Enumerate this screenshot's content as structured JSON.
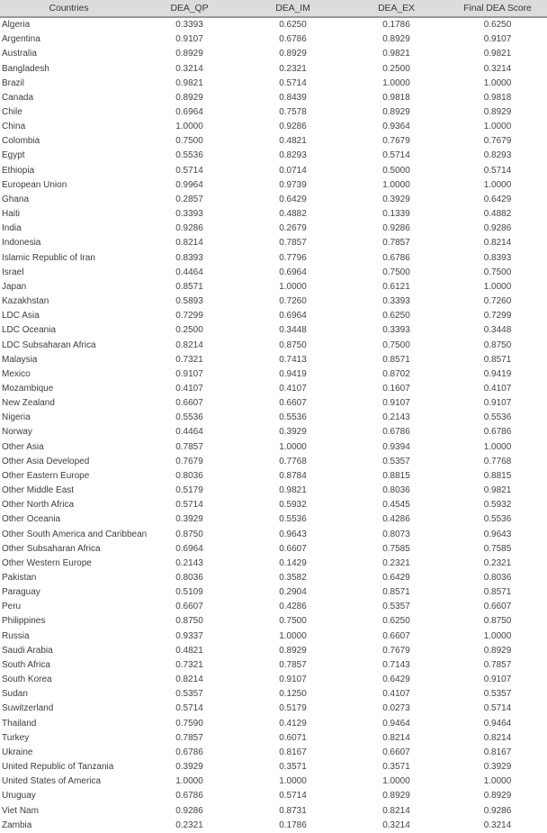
{
  "table": {
    "headers": [
      "Countries",
      "DEA_QP",
      "DEA_IM",
      "DEA_EX",
      "Final DEA Score"
    ],
    "rows": [
      [
        "Algeria",
        "0.3393",
        "0.6250",
        "0.1786",
        "0.6250"
      ],
      [
        "Argentina",
        "0.9107",
        "0.6786",
        "0.8929",
        "0.9107"
      ],
      [
        "Australia",
        "0.8929",
        "0.8929",
        "0.9821",
        "0.9821"
      ],
      [
        "Bangladesh",
        "0.3214",
        "0.2321",
        "0.2500",
        "0.3214"
      ],
      [
        "Brazil",
        "0.9821",
        "0.5714",
        "1.0000",
        "1.0000"
      ],
      [
        "Canada",
        "0.8929",
        "0.8439",
        "0.9818",
        "0.9818"
      ],
      [
        "Chile",
        "0.6964",
        "0.7578",
        "0.8929",
        "0.8929"
      ],
      [
        "China",
        "1.0000",
        "0.9286",
        "0.9364",
        "1.0000"
      ],
      [
        "Colombia",
        "0.7500",
        "0.4821",
        "0.7679",
        "0.7679"
      ],
      [
        "Egypt",
        "0.5536",
        "0.8293",
        "0.5714",
        "0.8293"
      ],
      [
        "Ethiopia",
        "0.5714",
        "0.0714",
        "0.5000",
        "0.5714"
      ],
      [
        "European Union",
        "0.9964",
        "0.9739",
        "1.0000",
        "1.0000"
      ],
      [
        "Ghana",
        "0.2857",
        "0.6429",
        "0.3929",
        "0.6429"
      ],
      [
        "Haiti",
        "0.3393",
        "0.4882",
        "0.1339",
        "0.4882"
      ],
      [
        "India",
        "0.9286",
        "0.2679",
        "0.9286",
        "0.9286"
      ],
      [
        "Indonesia",
        "0.8214",
        "0.7857",
        "0.7857",
        "0.8214"
      ],
      [
        "Islamic Republic of Iran",
        "0.8393",
        "0.7796",
        "0.6786",
        "0.8393"
      ],
      [
        "Israel",
        "0.4464",
        "0.6964",
        "0.7500",
        "0.7500"
      ],
      [
        "Japan",
        "0.8571",
        "1.0000",
        "0.6121",
        "1.0000"
      ],
      [
        "Kazakhstan",
        "0.5893",
        "0.7260",
        "0.3393",
        "0.7260"
      ],
      [
        "LDC Asia",
        "0.7299",
        "0.6964",
        "0.6250",
        "0.7299"
      ],
      [
        "LDC Oceania",
        "0.2500",
        "0.3448",
        "0.3393",
        "0.3448"
      ],
      [
        "LDC Subsaharan Africa",
        "0.8214",
        "0.8750",
        "0.7500",
        "0.8750"
      ],
      [
        "Malaysia",
        "0.7321",
        "0.7413",
        "0.8571",
        "0.8571"
      ],
      [
        "Mexico",
        "0.9107",
        "0.9419",
        "0.8702",
        "0.9419"
      ],
      [
        "Mozambique",
        "0.4107",
        "0.4107",
        "0.1607",
        "0.4107"
      ],
      [
        "New Zealand",
        "0.6607",
        "0.6607",
        "0.9107",
        "0.9107"
      ],
      [
        "Nigeria",
        "0.5536",
        "0.5536",
        "0.2143",
        "0.5536"
      ],
      [
        "Norway",
        "0.4464",
        "0.3929",
        "0.6786",
        "0.6786"
      ],
      [
        "Other Asia",
        "0.7857",
        "1.0000",
        "0.9394",
        "1.0000"
      ],
      [
        "Other Asia Developed",
        "0.7679",
        "0.7768",
        "0.5357",
        "0.7768"
      ],
      [
        "Other Eastern Europe",
        "0.8036",
        "0.8784",
        "0.8815",
        "0.8815"
      ],
      [
        "Other Middle East",
        "0.5179",
        "0.9821",
        "0.8036",
        "0.9821"
      ],
      [
        "Other North Africa",
        "0.5714",
        "0.5932",
        "0.4545",
        "0.5932"
      ],
      [
        "Other Oceania",
        "0.3929",
        "0.5536",
        "0.4286",
        "0.5536"
      ],
      [
        "Other South America and Caribbean",
        "0.8750",
        "0.9643",
        "0.8073",
        "0.9643"
      ],
      [
        "Other Subsaharan Africa",
        "0.6964",
        "0.6607",
        "0.7585",
        "0.7585"
      ],
      [
        "Other Western Europe",
        "0.2143",
        "0.1429",
        "0.2321",
        "0.2321"
      ],
      [
        "Pakistan",
        "0.8036",
        "0.3582",
        "0.6429",
        "0.8036"
      ],
      [
        "Paraguay",
        "0.5109",
        "0.2904",
        "0.8571",
        "0.8571"
      ],
      [
        "Peru",
        "0.6607",
        "0.4286",
        "0.5357",
        "0.6607"
      ],
      [
        "Philippines",
        "0.8750",
        "0.7500",
        "0.6250",
        "0.8750"
      ],
      [
        "Russia",
        "0.9337",
        "1.0000",
        "0.6607",
        "1.0000"
      ],
      [
        "Saudi Arabia",
        "0.4821",
        "0.8929",
        "0.7679",
        "0.8929"
      ],
      [
        "South Africa",
        "0.7321",
        "0.7857",
        "0.7143",
        "0.7857"
      ],
      [
        "South Korea",
        "0.8214",
        "0.9107",
        "0.6429",
        "0.9107"
      ],
      [
        "Sudan",
        "0.5357",
        "0.1250",
        "0.4107",
        "0.5357"
      ],
      [
        "Suwitzerland",
        "0.5714",
        "0.5179",
        "0.0273",
        "0.5714"
      ],
      [
        "Thailand",
        "0.7590",
        "0.4129",
        "0.9464",
        "0.9464"
      ],
      [
        "Turkey",
        "0.7857",
        "0.6071",
        "0.8214",
        "0.8214"
      ],
      [
        "Ukraine",
        "0.6786",
        "0.8167",
        "0.6607",
        "0.8167"
      ],
      [
        "United Republic of Tanzania",
        "0.3929",
        "0.3571",
        "0.3571",
        "0.3929"
      ],
      [
        "United States of America",
        "1.0000",
        "1.0000",
        "1.0000",
        "1.0000"
      ],
      [
        "Uruguay",
        "0.6786",
        "0.5714",
        "0.8929",
        "0.8929"
      ],
      [
        "Viet Nam",
        "0.9286",
        "0.8731",
        "0.8214",
        "0.9286"
      ],
      [
        "Zambia",
        "0.2321",
        "0.1786",
        "0.3214",
        "0.3214"
      ]
    ]
  }
}
